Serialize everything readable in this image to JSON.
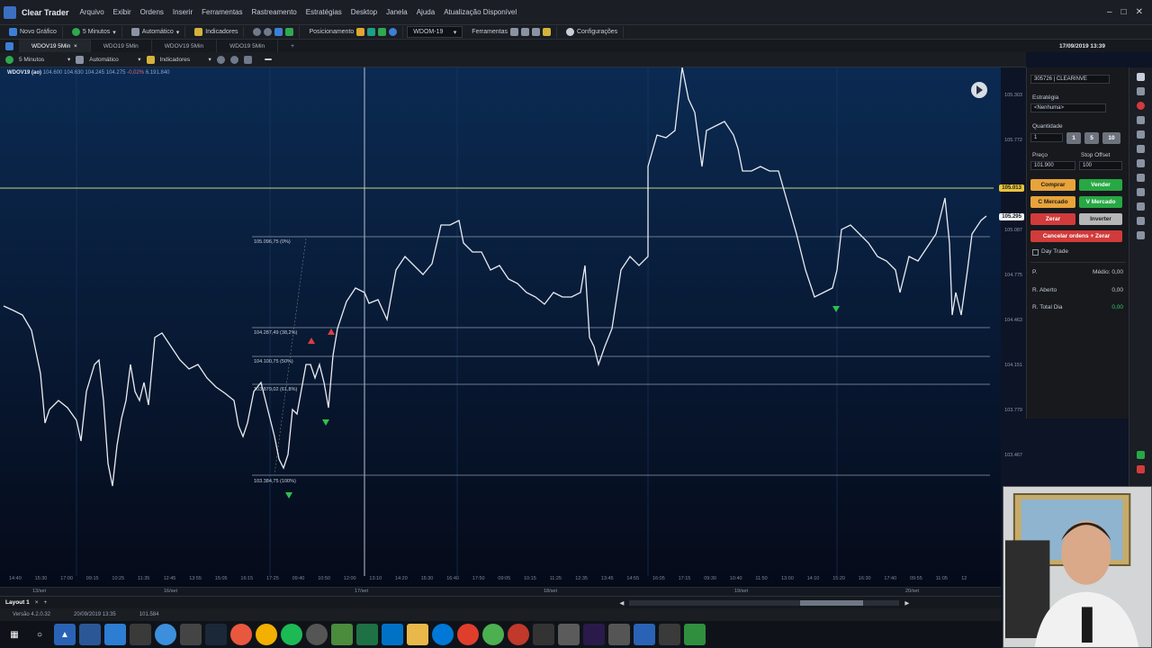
{
  "app": {
    "title": "Clear Trader",
    "menu": [
      "Arquivo",
      "Exibir",
      "Ordens",
      "Inserir",
      "Ferramentas",
      "Rastreamento",
      "Estratégias",
      "Desktop",
      "Janela",
      "Ajuda",
      "Atualização Disponível"
    ]
  },
  "toolbar1": {
    "new_chart": "Novo Gráfico",
    "interval": "5 Minutos",
    "mode": "Automático",
    "indicators": "Indicadores",
    "tools_label": "Posicionamento",
    "symbol": "WDOM-19",
    "tools2": "Ferramentas",
    "settings": "Configurações"
  },
  "tabs": [
    "WDOV19 5Min",
    "WDO19 5Min",
    "WDOV19 5Min",
    "WDO19 5Min"
  ],
  "datetime": "17/09/2019 13:39",
  "toolbar2": {
    "interval": "5 Minutos",
    "mode": "Automático",
    "indicators": "Indicadores"
  },
  "quote": {
    "symbol": "WDOV19 (ao)",
    "values": "104.600  104.630  104.245  104.275",
    "change": "-0,02%",
    "volume": "6.191.840"
  },
  "price_axis": [
    "105.303",
    "105.772",
    "105.087",
    "104.775",
    "104.463",
    "104.151",
    "103.779",
    "103.467"
  ],
  "price_tags": {
    "buy_line": "105.013",
    "last": "105.295"
  },
  "fibo_labels": [
    "105.096,75 (0%)",
    "104.287,49 (38,2%)",
    "104.100,75 (50%)",
    "103.879,02 (61,8%)",
    "103.384,75 (100%)"
  ],
  "time_labels": [
    "14:40",
    "15:30",
    "17:00",
    "09:15",
    "10:25",
    "11:35",
    "12:45",
    "13:55",
    "15:05",
    "16:15",
    "17:25",
    "09:40",
    "10:50",
    "12:00",
    "13:10",
    "14:20",
    "15:30",
    "16:40",
    "17:50",
    "09:05",
    "10:15",
    "11:25",
    "12:35",
    "13:45",
    "14:55",
    "16:05",
    "17:15",
    "09:30",
    "10:40",
    "11:50",
    "13:00",
    "14:10",
    "15:20",
    "16:30",
    "17:40",
    "09:55",
    "11:05",
    "12"
  ],
  "date_labels": [
    "13/set",
    "16/set",
    "17/set",
    "18/set",
    "19/set",
    "20/set"
  ],
  "bottombar": {
    "layout": "Layout 1"
  },
  "status": {
    "version": "Versão 4.2.0.32",
    "date": "20/09/2019 13:35",
    "price": "101.584"
  },
  "order_panel": {
    "account": "305726 | CLEARINVE",
    "strategy_label": "Estratégia",
    "strategy_value": "<Nenhuma>",
    "qty_label": "Quantidade",
    "qty_value": "1",
    "qty_buttons": [
      "1",
      "5",
      "10"
    ],
    "price_label": "Preço",
    "price_value": "101.900",
    "stop_label": "Stop Offset",
    "stop_value": "100",
    "buy": "Comprar",
    "sell": "Vender",
    "buy_market": "C Mercado",
    "sell_market": "V Mercado",
    "zero": "Zerar",
    "invert": "Inverter",
    "cancel_all": "Cancelar ordens + Zerar",
    "daytrade": "Day Trade",
    "row1_label": "P.",
    "row1_value": "Médio: 0,00",
    "row2_label": "R. Aberto",
    "row2_value": "0,00",
    "row3_label": "R. Total Dia",
    "row3_value": "0,00"
  },
  "colors": {
    "buy": "#e8a33a",
    "sell": "#27a844",
    "zero": "#d23b3b",
    "invert": "#b7b7b7",
    "chart_bg_top": "#0b2a52",
    "chart_bg_bottom": "#050a18"
  }
}
